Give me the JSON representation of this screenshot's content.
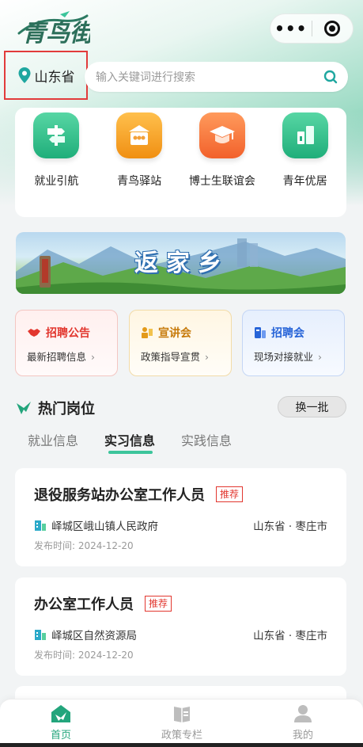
{
  "app": {
    "logo_text": "青鸟街"
  },
  "capsule": {
    "more_icon": "more-dots-icon",
    "close_icon": "target-circle-icon"
  },
  "location": {
    "province": "山东省",
    "icon": "location-pin-icon"
  },
  "search": {
    "placeholder": "输入关键词进行搜索",
    "icon": "search-icon"
  },
  "quick_links": [
    {
      "label": "就业引航",
      "icon": "signpost-icon",
      "color": "#1fae7a"
    },
    {
      "label": "青鸟驿站",
      "icon": "station-icon",
      "color": "#f08f12"
    },
    {
      "label": "博士生联谊会",
      "icon": "graduation-cap-icon",
      "color": "#f2612b"
    },
    {
      "label": "青年优居",
      "icon": "building-icon",
      "color": "#1fae7a"
    }
  ],
  "banner": {
    "text": "返家乡"
  },
  "categories": [
    {
      "title": "招聘公告",
      "subtitle": "最新招聘信息",
      "icon": "handshake-icon",
      "color": "#e2372f"
    },
    {
      "title": "宣讲会",
      "subtitle": "政策指导宣贯",
      "icon": "presentation-icon",
      "color": "#c77b0c"
    },
    {
      "title": "招聘会",
      "subtitle": "现场对接就业",
      "icon": "job-fair-icon",
      "color": "#2764d8"
    }
  ],
  "hot_jobs": {
    "title": "热门岗位",
    "refresh_label": "换一批",
    "tabs": [
      "就业信息",
      "实习信息",
      "实践信息"
    ],
    "active_tab": "实习信息",
    "accent": "#3cc59b",
    "jobs": [
      {
        "title": "退役服务站办公室工作人员",
        "tag": "推荐",
        "org": "峄城区峨山镇人民政府",
        "location": "山东省 · 枣庄市",
        "date": "发布时间: 2024-12-20"
      },
      {
        "title": "办公室工作人员",
        "tag": "推荐",
        "org": "峄城区自然资源局",
        "location": "山东省 · 枣庄市",
        "date": "发布时间: 2024-12-20"
      }
    ]
  },
  "tabbar": [
    {
      "label": "首页",
      "icon": "home-bird-icon",
      "active": true
    },
    {
      "label": "政策专栏",
      "icon": "policy-book-icon",
      "active": false
    },
    {
      "label": "我的",
      "icon": "user-icon",
      "active": false
    }
  ]
}
